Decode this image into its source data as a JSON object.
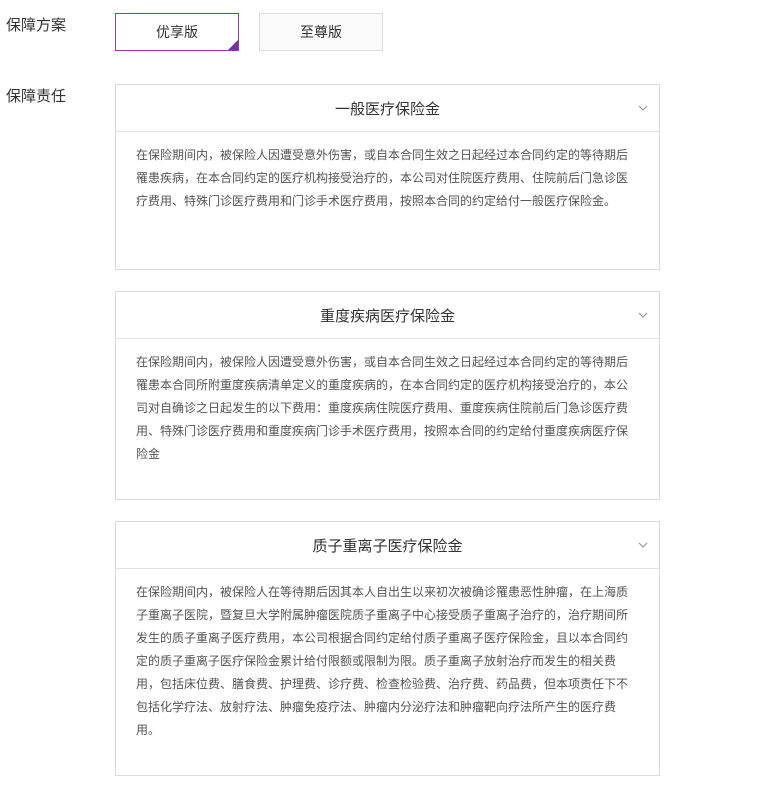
{
  "plan": {
    "label": "保障方案",
    "options": [
      {
        "label": "优享版",
        "selected": true
      },
      {
        "label": "至尊版",
        "selected": false
      }
    ]
  },
  "coverage": {
    "label": "保障责任",
    "items": [
      {
        "title": "一般医疗保险金",
        "icon": "chevron-down-icon",
        "text": "在保险期间内，被保险人因遭受意外伤害，或自本合同生效之日起经过本合同约定的等待期后罹患疾病，在本合同约定的医疗机构接受治疗的，本公司对住院医疗费用、住院前后门急诊医疗费用、特殊门诊医疗费用和门诊手术医疗费用，按照本合同的约定给付一般医疗保险金。"
      },
      {
        "title": "重度疾病医疗保险金",
        "icon": "chevron-down-icon",
        "text": "在保险期间内，被保险人因遭受意外伤害，或自本合同生效之日起经过本合同约定的等待期后罹患本合同所附重度疾病清单定义的重度疾病的，在本合同约定的医疗机构接受治疗的，本公司对自确诊之日起发生的以下费用：重度疾病住院医疗费用、重度疾病住院前后门急诊医疗费用、特殊门诊医疗费用和重度疾病门诊手术医疗费用，按照本合同的约定给付重度疾病医疗保险金"
      },
      {
        "title": "质子重离子医疗保险金",
        "icon": "chevron-down-icon",
        "text": "在保险期间内，被保险人在等待期后因其本人自出生以来初次被确诊罹患恶性肿瘤，在上海质子重离子医院，暨复旦大学附属肿瘤医院质子重离子中心接受质子重离子治疗的，治疗期间所发生的质子重离子医疗费用，本公司根据合同约定给付质子重离子医疗保险金，且以本合同约定的质子重离子医疗保险金累计给付限额或限制为限。质子重离子放射治疗而发生的相关费用，包括床位费、膳食费、护理费、诊疗费、检查检验费、治疗费、药品费，但本项责任下不包括化学疗法、放射疗法、肿瘤免疫疗法、肿瘤内分泌疗法和肿瘤靶向疗法所产生的医疗费用。"
      }
    ]
  },
  "colors": {
    "accent": "#7b2f9f",
    "border": "#d9d9d9",
    "text": "#333333",
    "body_text": "#555555"
  }
}
